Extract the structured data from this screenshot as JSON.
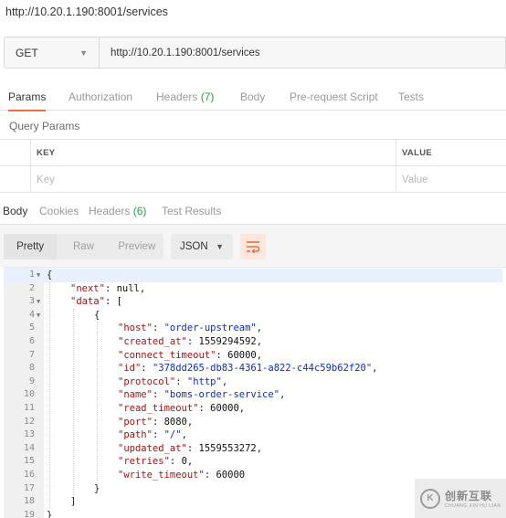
{
  "window": {
    "title": "http://10.20.1.190:8001/services"
  },
  "request": {
    "method": "GET",
    "url": "http://10.20.1.190:8001/services"
  },
  "request_tabs": [
    {
      "label": "Params",
      "active": true
    },
    {
      "label": "Authorization"
    },
    {
      "label": "Headers",
      "count": "(7)"
    },
    {
      "label": "Body"
    },
    {
      "label": "Pre-request Script"
    },
    {
      "label": "Tests"
    }
  ],
  "query_params": {
    "title": "Query Params",
    "headers": {
      "key": "KEY",
      "value": "VALUE"
    },
    "placeholder": {
      "key": "Key",
      "value": "Value"
    }
  },
  "response_tabs": [
    {
      "label": "Body",
      "active": true
    },
    {
      "label": "Cookies"
    },
    {
      "label": "Headers",
      "count": "(6)"
    },
    {
      "label": "Test Results"
    }
  ],
  "response_toolbar": {
    "views": [
      "Pretty",
      "Raw",
      "Preview"
    ],
    "active_view": "Pretty",
    "format": "JSON",
    "wrap_icon": "wrap-lines-icon"
  },
  "code_lines": [
    {
      "n": "1",
      "fold": true,
      "indent": 0,
      "text": "{"
    },
    {
      "n": "2",
      "indent": 1,
      "key": "next",
      "value": "null",
      "vtype": "n",
      "comma": true
    },
    {
      "n": "3",
      "fold": true,
      "indent": 1,
      "key": "data",
      "value": "[",
      "vtype": "p"
    },
    {
      "n": "4",
      "fold": true,
      "indent": 2,
      "text": "{"
    },
    {
      "n": "5",
      "indent": 3,
      "key": "host",
      "value": "\"order-upstream\"",
      "vtype": "s",
      "comma": true
    },
    {
      "n": "6",
      "indent": 3,
      "key": "created_at",
      "value": "1559294592",
      "vtype": "n",
      "comma": true
    },
    {
      "n": "7",
      "indent": 3,
      "key": "connect_timeout",
      "value": "60000",
      "vtype": "n",
      "comma": true
    },
    {
      "n": "8",
      "indent": 3,
      "key": "id",
      "value": "\"378dd265-db83-4361-a822-c44c59b62f20\"",
      "vtype": "s",
      "comma": true
    },
    {
      "n": "9",
      "indent": 3,
      "key": "protocol",
      "value": "\"http\"",
      "vtype": "s",
      "comma": true
    },
    {
      "n": "10",
      "indent": 3,
      "key": "name",
      "value": "\"boms-order-service\"",
      "vtype": "s",
      "comma": true
    },
    {
      "n": "11",
      "indent": 3,
      "key": "read_timeout",
      "value": "60000",
      "vtype": "n",
      "comma": true
    },
    {
      "n": "12",
      "indent": 3,
      "key": "port",
      "value": "8080",
      "vtype": "n",
      "comma": true
    },
    {
      "n": "13",
      "indent": 3,
      "key": "path",
      "value": "\"/\"",
      "vtype": "s",
      "comma": true
    },
    {
      "n": "14",
      "indent": 3,
      "key": "updated_at",
      "value": "1559553272",
      "vtype": "n",
      "comma": true
    },
    {
      "n": "15",
      "indent": 3,
      "key": "retries",
      "value": "0",
      "vtype": "n",
      "comma": true
    },
    {
      "n": "16",
      "indent": 3,
      "key": "write_timeout",
      "value": "60000",
      "vtype": "n"
    },
    {
      "n": "17",
      "indent": 2,
      "text": "}"
    },
    {
      "n": "18",
      "indent": 1,
      "text": "]"
    },
    {
      "n": "19",
      "indent": 0,
      "text": "}"
    }
  ],
  "watermark": {
    "text": "创新互联",
    "sub": "CHUANG XIN HU LIAN",
    "glyph": "K"
  },
  "colors": {
    "accent": "#f26b3a",
    "count": "#20a447",
    "json_key": "#a21515",
    "json_string": "#0d2bd1"
  }
}
